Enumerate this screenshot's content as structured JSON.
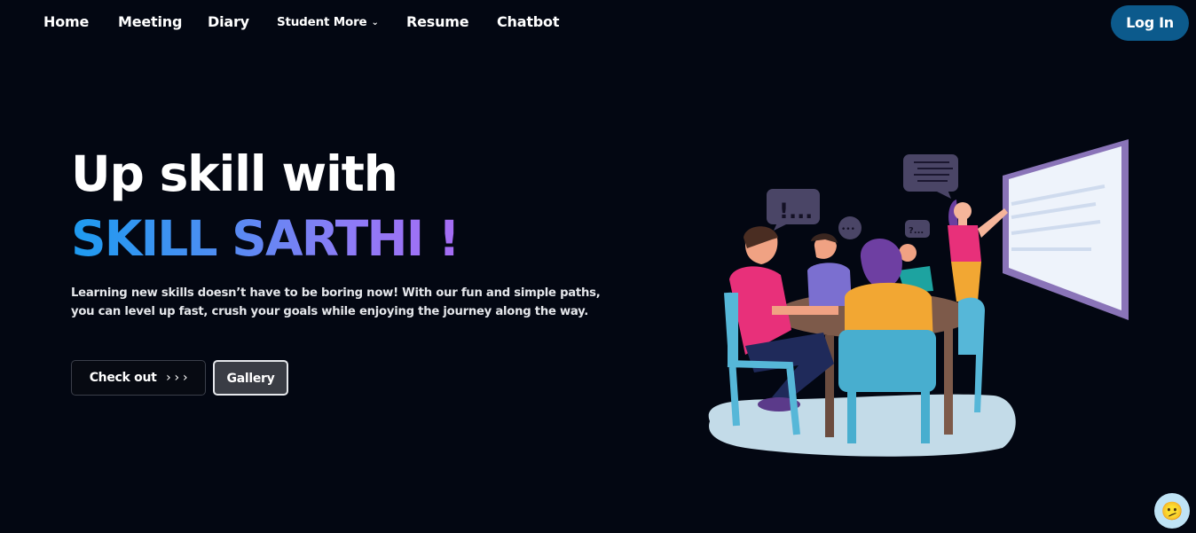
{
  "nav": {
    "items": [
      {
        "label": "Home"
      },
      {
        "label": "Meeting"
      },
      {
        "label": "Diary"
      },
      {
        "label": "Student More"
      },
      {
        "label": "Resume"
      },
      {
        "label": "Chatbot"
      }
    ],
    "login_label": "Log In"
  },
  "hero": {
    "line1": "Up skill with",
    "line2": "SKILL SARTHI !",
    "description": "Learning new skills doesn’t have to be boring now! With our fun and simple paths, you can level up fast, crush your goals while enjoying the journey along the way.",
    "check_out_label": "Check out",
    "check_out_arrows": "› › ›",
    "gallery_label": "Gallery"
  },
  "illustration": {
    "bubble_exclaim": "!...",
    "bubble_dots": "•••",
    "bubble_question": "?..."
  },
  "chat_widget": {
    "emoji": "🫤"
  },
  "colors": {
    "background": "#030712",
    "login_bg": "#0c5a8c",
    "gradient_start": "#1d9bf0",
    "gradient_end": "#a66cf4"
  }
}
